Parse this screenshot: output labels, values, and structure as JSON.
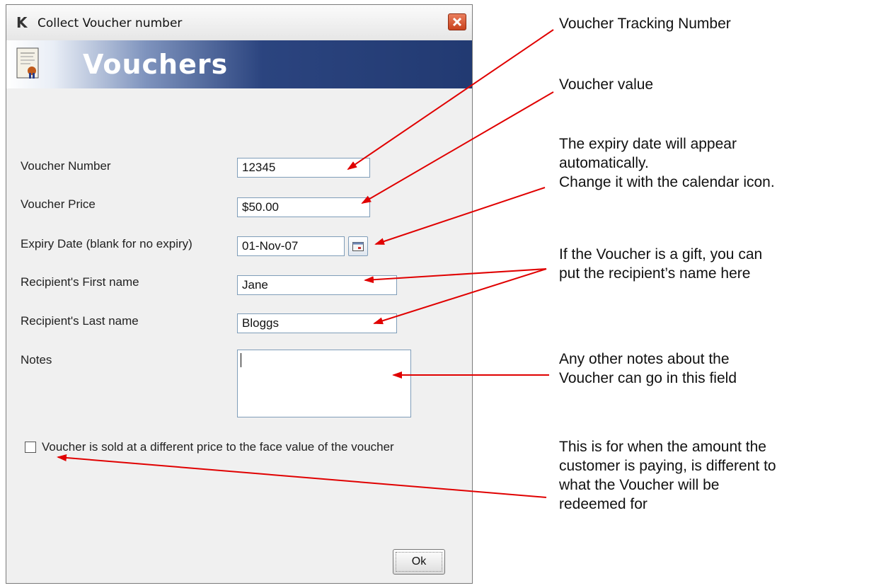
{
  "window": {
    "title": "Collect Voucher number",
    "banner_title": "Vouchers"
  },
  "form": {
    "voucher_number": {
      "label": "Voucher Number",
      "value": "12345"
    },
    "voucher_price": {
      "label": "Voucher Price",
      "value": "$50.00"
    },
    "expiry_date": {
      "label": "Expiry Date (blank for no expiry)",
      "value": "01-Nov-07"
    },
    "first_name": {
      "label": "Recipient's First name",
      "value": "Jane"
    },
    "last_name": {
      "label": "Recipient's Last name",
      "value": "Bloggs"
    },
    "notes": {
      "label": "Notes",
      "value": ""
    },
    "different_price": {
      "label": "Voucher is sold at a different price to the face value of the voucher",
      "checked": false
    },
    "ok_label": "Ok"
  },
  "annotations": {
    "tracking": "Voucher Tracking Number",
    "value": "Voucher value",
    "expiry": [
      "The expiry date will appear",
      "automatically.",
      "Change it with the calendar icon."
    ],
    "recipient": [
      "If the Voucher is a gift, you can",
      "put the recipient’s name here"
    ],
    "notes": [
      "Any other notes about the",
      "Voucher can go in this field"
    ],
    "price": [
      "This is for when the amount the",
      "customer is paying, is different to",
      "what the Voucher will be",
      "redeemed for"
    ]
  },
  "colors": {
    "arrow": "#e00000",
    "banner_dark": "#223a72",
    "field_border": "#7f9db9"
  },
  "icons": [
    "app-logo-icon",
    "close-icon",
    "voucher-certificate-icon",
    "calendar-icon"
  ]
}
